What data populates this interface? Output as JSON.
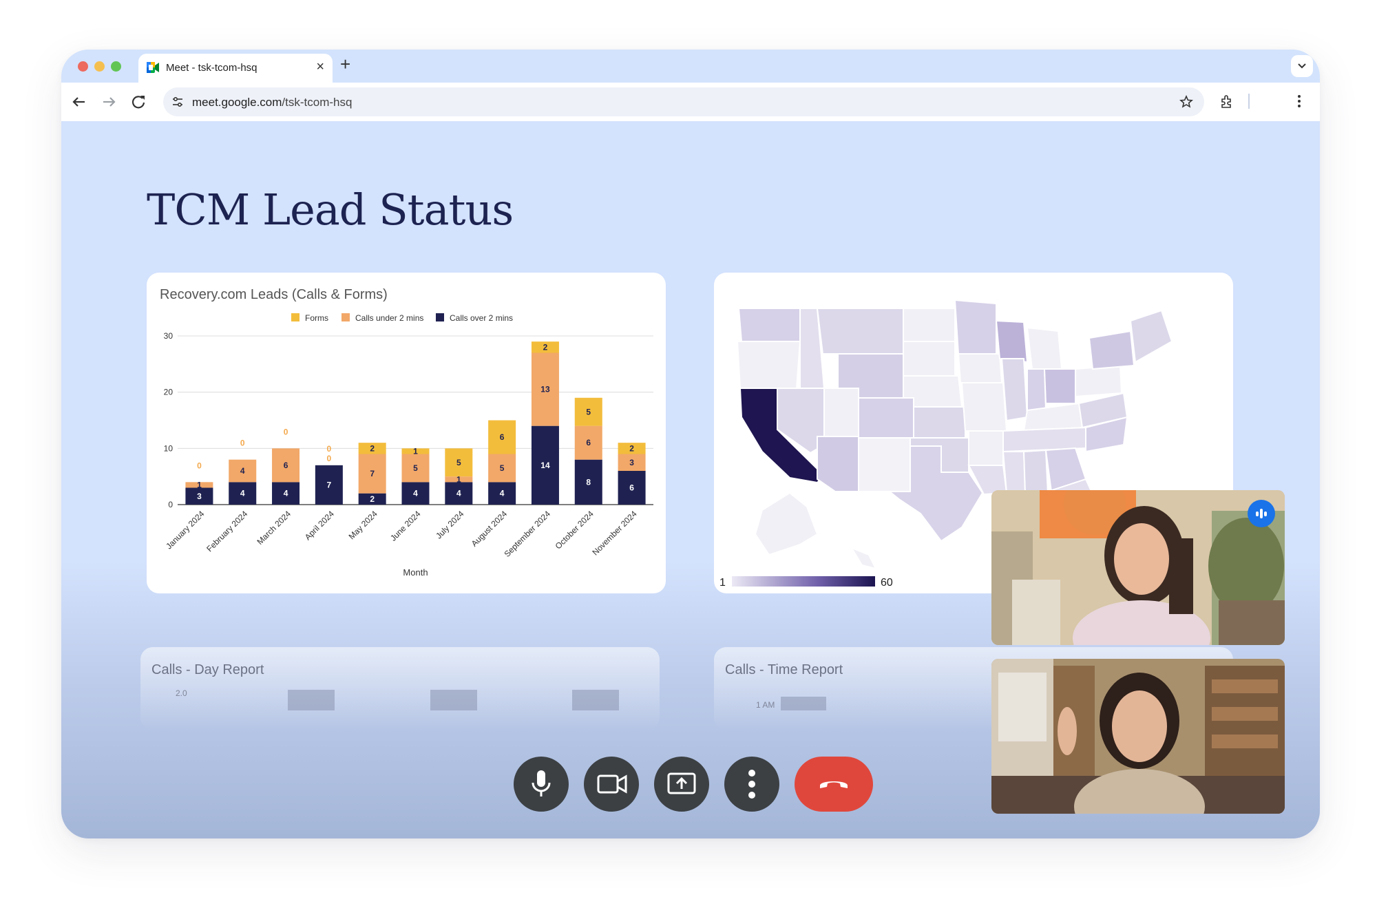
{
  "browser": {
    "tab_title": "Meet - tsk-tcom-hsq",
    "tab_close": "×",
    "new_tab": "+",
    "url_host": "meet.google.com",
    "url_path": "/tsk-tcom-hsq"
  },
  "slide": {
    "title": "TCM Lead Status",
    "faded_left_title": "Calls - Day Report",
    "faded_left_tick": "2.0",
    "faded_right_title": "Calls - Time Report",
    "faded_right_tick": "1 AM"
  },
  "map": {
    "legend_min": "1",
    "legend_max": "60",
    "colors": {
      "low": "#ece9f5",
      "high": "#1b1450"
    }
  },
  "colors": {
    "forms": "#f3bd3c",
    "calls_under": "#f2a869",
    "calls_over": "#1f2251",
    "hangup": "#e0473c",
    "control": "#3c4043"
  },
  "icons": [
    "mic-icon",
    "camera-icon",
    "present-icon",
    "more-options-icon",
    "hangup-icon",
    "speaking-indicator-icon",
    "bookmark-star-icon",
    "extensions-icon",
    "browser-menu-icon",
    "back-icon",
    "forward-icon",
    "reload-icon",
    "site-info-icon"
  ],
  "chart_data": {
    "type": "bar",
    "stacked": true,
    "title": "Recovery.com Leads (Calls & Forms)",
    "xlabel": "Month",
    "ylabel": "",
    "ylim": [
      0,
      30
    ],
    "yticks": [
      "0",
      "10",
      "20",
      "30"
    ],
    "grid": true,
    "legend_position": "top",
    "categories": [
      "January 2024",
      "February 2024",
      "March 2024",
      "April 2024",
      "May 2024",
      "June 2024",
      "July 2024",
      "August 2024",
      "September 2024",
      "October 2024",
      "November 2024"
    ],
    "series": [
      {
        "name": "Calls over 2 mins",
        "values": [
          3,
          4,
          4,
          7,
          2,
          4,
          4,
          4,
          14,
          8,
          6
        ]
      },
      {
        "name": "Calls under 2 mins",
        "values": [
          1,
          4,
          6,
          0,
          7,
          5,
          1,
          5,
          13,
          6,
          3
        ]
      },
      {
        "name": "Forms",
        "values": [
          0,
          0,
          0,
          0,
          2,
          1,
          5,
          6,
          2,
          5,
          2
        ]
      }
    ]
  }
}
